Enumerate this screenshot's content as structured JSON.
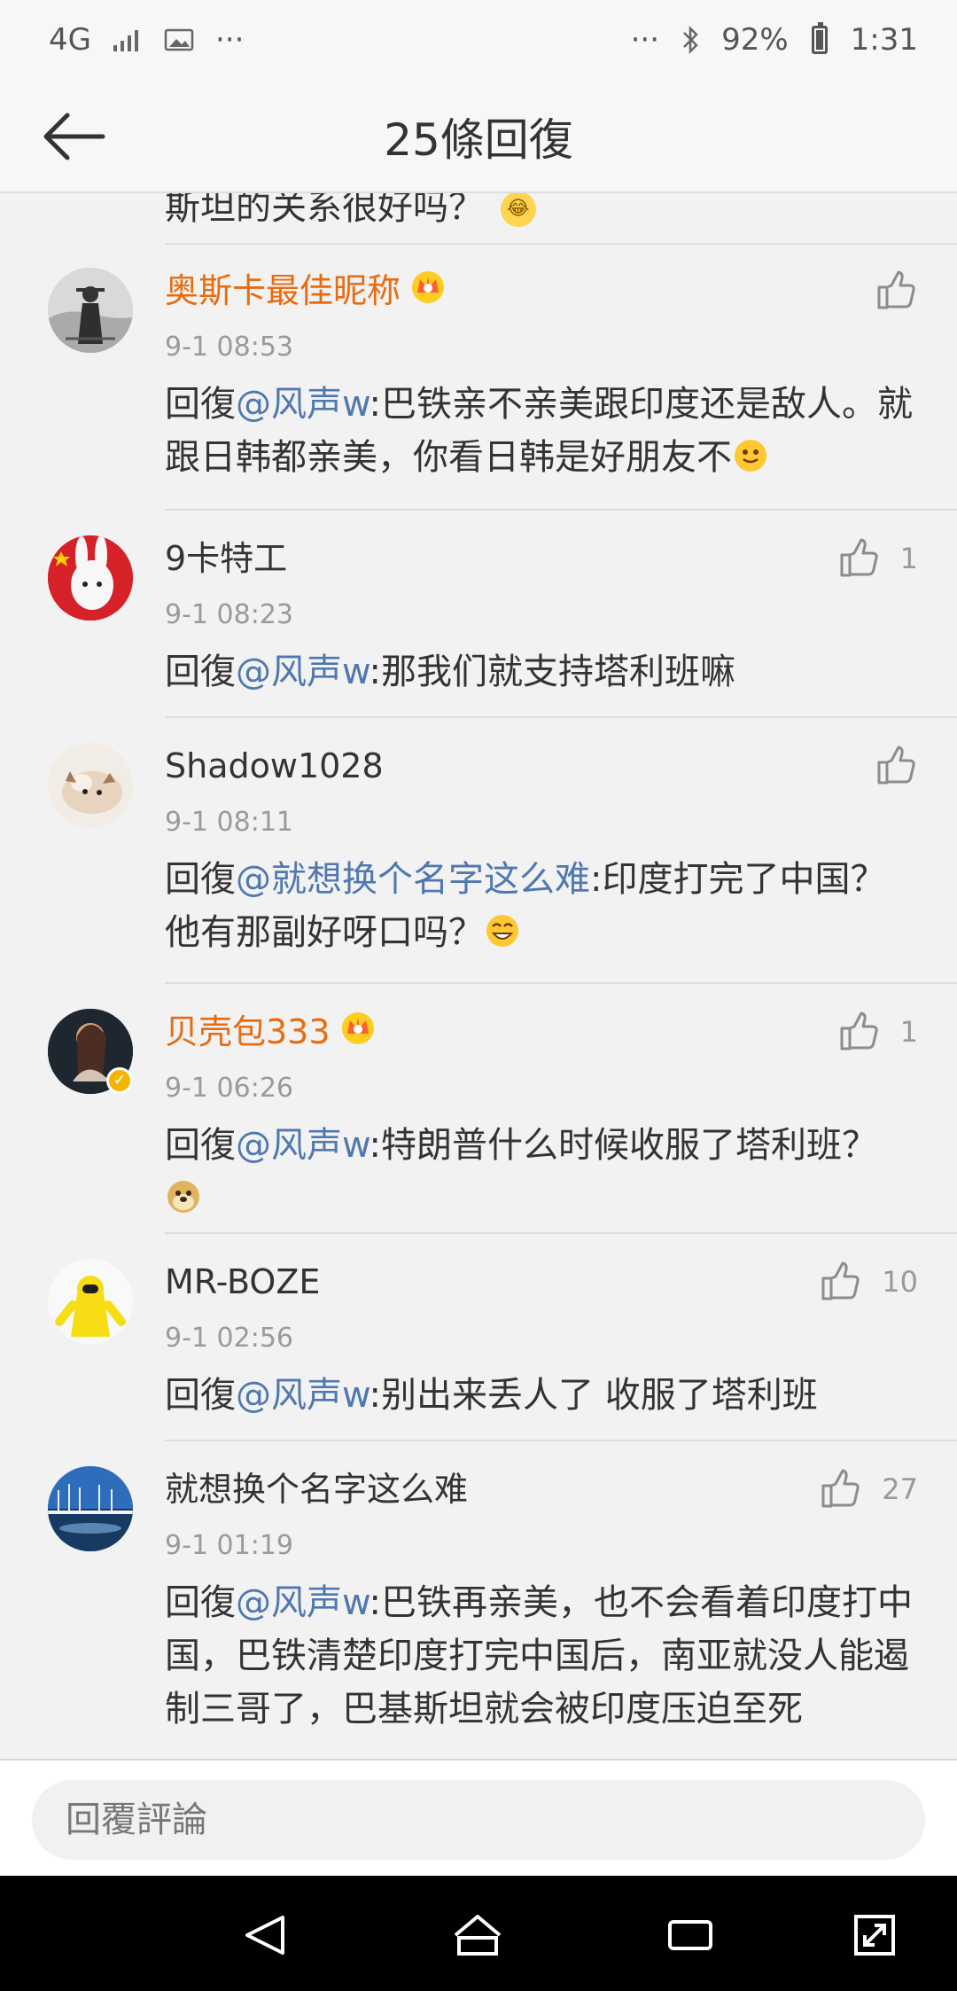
{
  "status_bar": {
    "network": "4G",
    "more": "···",
    "battery_percent": "92%",
    "time": "1:31"
  },
  "header": {
    "title": "25條回復"
  },
  "partial_comment": {
    "text": "斯坦的关系很好吗？"
  },
  "comments": [
    {
      "name": "奥斯卡最佳昵称",
      "vip": true,
      "time": "9-1 08:53",
      "prefix": "回復",
      "mention": "@风声w",
      "text": ":巴铁亲不亲美跟印度还是敌人。就跟日韩都亲美，你看日韩是好朋友不",
      "likes": "",
      "emoji": "smile"
    },
    {
      "name": "9卡特工",
      "vip": false,
      "time": "9-1 08:23",
      "prefix": "回復",
      "mention": "@风声w",
      "text": ":那我们就支持塔利班嘛",
      "likes": "1"
    },
    {
      "name": "Shadow1028",
      "vip": false,
      "time": "9-1 08:11",
      "prefix": "回復",
      "mention": "@就想换个名字这么难",
      "text": ":印度打完了中国？他有那副好呀口吗？",
      "likes": "",
      "emoji": "laugh"
    },
    {
      "name": "贝壳包333",
      "vip": true,
      "time": "9-1 06:26",
      "prefix": "回復",
      "mention": "@风声w",
      "text": ":特朗普什么时候收服了塔利班？",
      "likes": "1",
      "emoji": "doge"
    },
    {
      "name": "MR-BOZE",
      "vip": false,
      "time": "9-1 02:56",
      "prefix": "回復",
      "mention": "@风声w",
      "text": ":别出来丢人了 收服了塔利班",
      "likes": "10"
    },
    {
      "name": "就想换个名字这么难",
      "vip": false,
      "time": "9-1 01:19",
      "prefix": "回復",
      "mention": "@风声w",
      "text": ":巴铁再亲美，也不会看着印度打中国，巴铁清楚印度打完中国后，南亚就没人能遏制三哥了，巴基斯坦就会被印度压迫至死",
      "likes": "27"
    }
  ],
  "reply_bar": {
    "placeholder": "回覆評論"
  },
  "icons": {
    "back": "arrow-left-icon",
    "like": "thumbs-up-icon",
    "crown": "vip-crown-icon"
  }
}
